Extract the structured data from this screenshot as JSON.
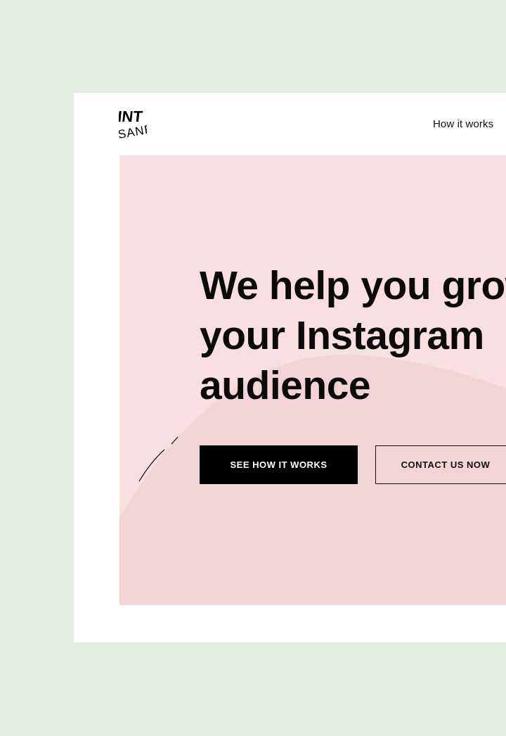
{
  "logo": {
    "text_line1": "INT",
    "text_line2": "SANE"
  },
  "nav": {
    "how_it_works": "How it works"
  },
  "hero": {
    "headline_lines": [
      "We help you grow",
      "your Instagram",
      "audience"
    ],
    "primary_button": "SEE HOW IT WORKS",
    "secondary_button": "CONTACT US NOW"
  },
  "colors": {
    "page_background": "#e5eee3",
    "frame_background": "#ffffff",
    "hero_background": "#f8dfe2",
    "hero_arc": "#f2d3d6",
    "text": "#0b0b0b"
  }
}
